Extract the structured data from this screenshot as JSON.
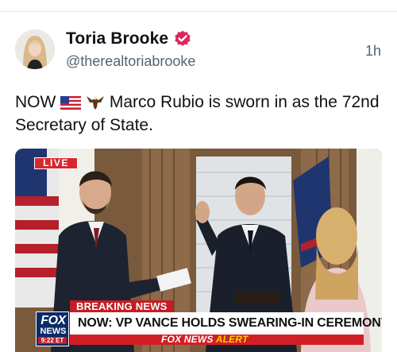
{
  "post": {
    "author_name": "Toria Brooke",
    "handle": "@therealtoriabrooke",
    "time": "1h",
    "text_prefix": "NOW",
    "text_body": " Marco Rubio is sworn in as the 72nd Secretary of State.",
    "emojis": [
      "us-flag-emoji",
      "eagle-emoji"
    ],
    "verified_color": "#e0245e"
  },
  "media": {
    "live_label": "LIVE",
    "breaking_label": "BREAKING NEWS",
    "headline": "NOW: VP VANCE HOLDS SWEARING-IN CEREMONY FOR RUBIO",
    "network_logo_top": "FOX",
    "network_logo_bottom": "NEWS",
    "clock": "9:22 ET",
    "alert_prefix": "FOX NEWS",
    "alert_suffix": "ALERT",
    "brand_colors": {
      "red": "#c41d23",
      "navy": "#0b2a67",
      "yellow": "#ffd200"
    }
  }
}
